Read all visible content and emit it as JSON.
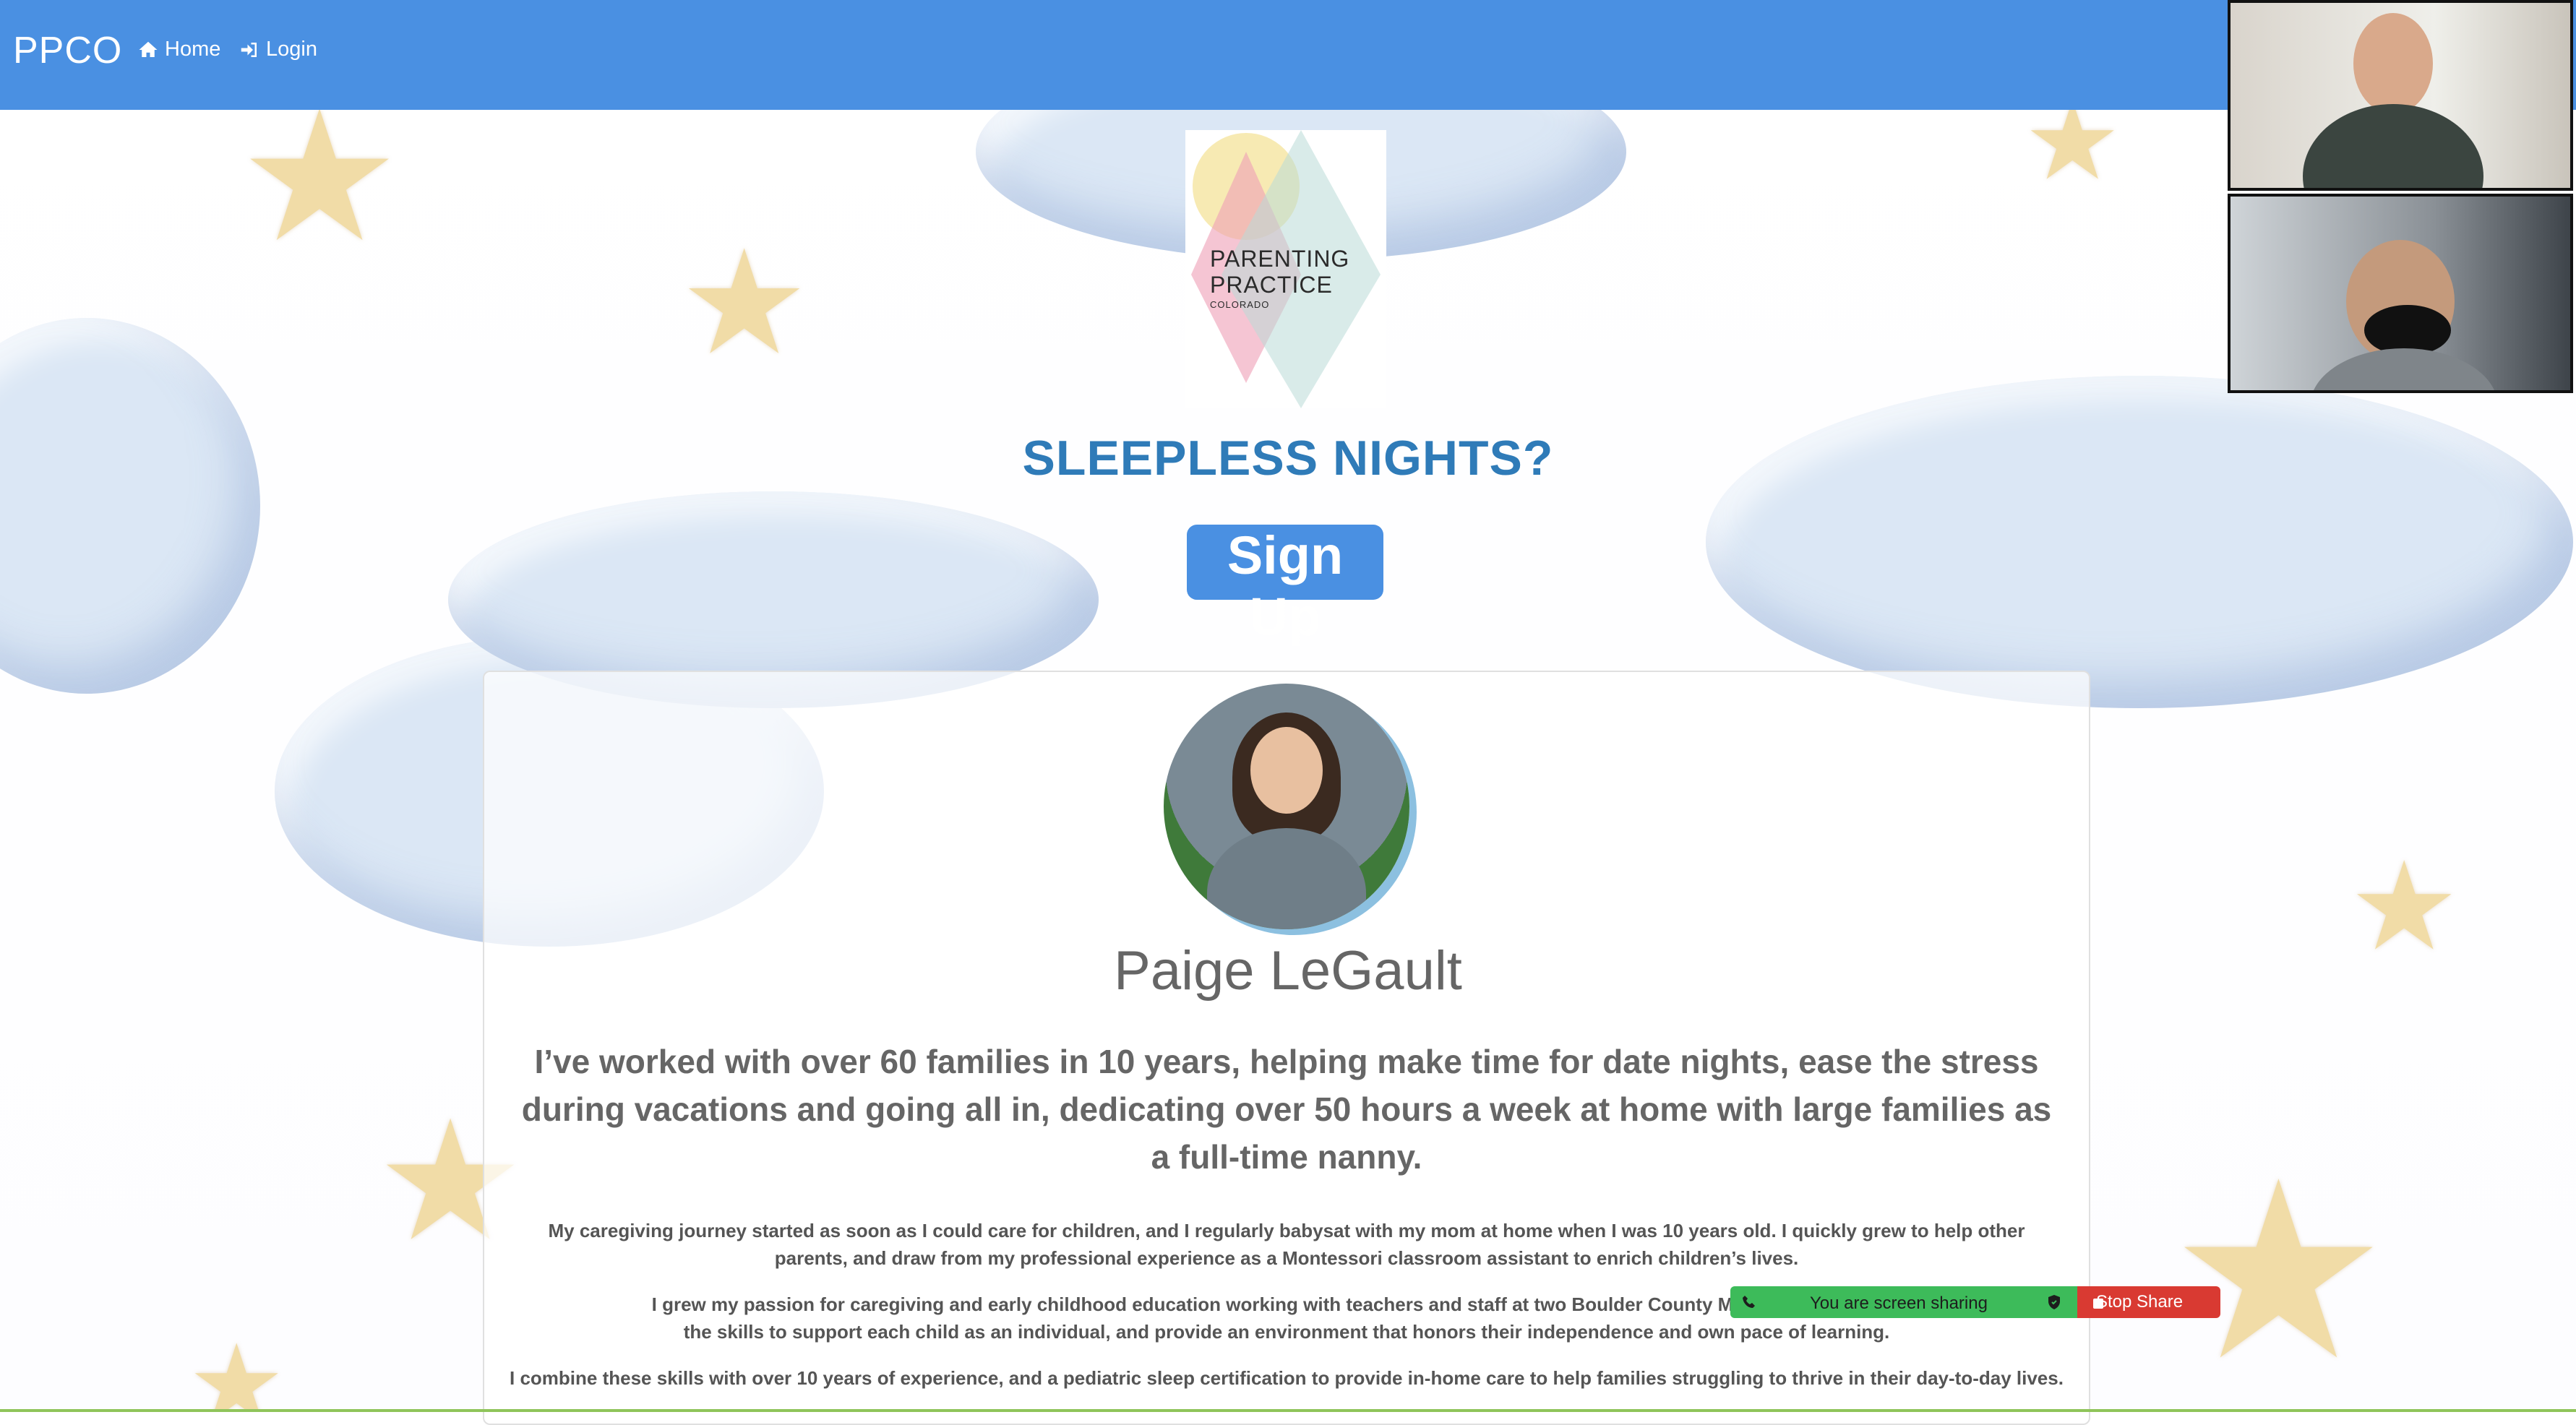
{
  "navbar": {
    "brand": "PPCO",
    "links": [
      {
        "label": "Home",
        "icon": "home-icon"
      },
      {
        "label": "Login",
        "icon": "sign-in-icon"
      }
    ],
    "color": "#4a90e2"
  },
  "logo": {
    "line1": "PARENTING",
    "line2": "PRACTICE",
    "line3": "COLORADO"
  },
  "hero": {
    "headline": "SLEEPLESS NIGHTS?",
    "signup_label": "Sign Up"
  },
  "profile": {
    "name": "Paige LeGault",
    "tagline": "I’ve worked with over 60 families in 10 years, helping make time for date nights, ease the stress during vacations and going all in, dedicating over 50 hours a week at home with large families as a full-time nanny.",
    "paragraphs": [
      "My caregiving journey started as soon as I could care for children, and I regularly babysat with my mom at home when I was 10 years old. I quickly grew to help other parents, and draw from my professional experience as a Montessori classroom assistant to enrich children’s lives.",
      "I grew my passion for caregiving and early childhood education working with teachers and staff at two Boulder County Montessori schools ov",
      "the skills to support each child as an individual, and provide an environment that honors their independence and own pace of learning.",
      "I combine these skills with over 10 years of experience, and a pediatric sleep certification to provide in-home care to help families struggling to thrive in their day-to-day lives."
    ]
  },
  "screen_share": {
    "status_text": "You are screen sharing",
    "stop_label": "Stop Share",
    "colors": {
      "bar": "#3dbb5a",
      "stop": "#d93a32"
    }
  }
}
